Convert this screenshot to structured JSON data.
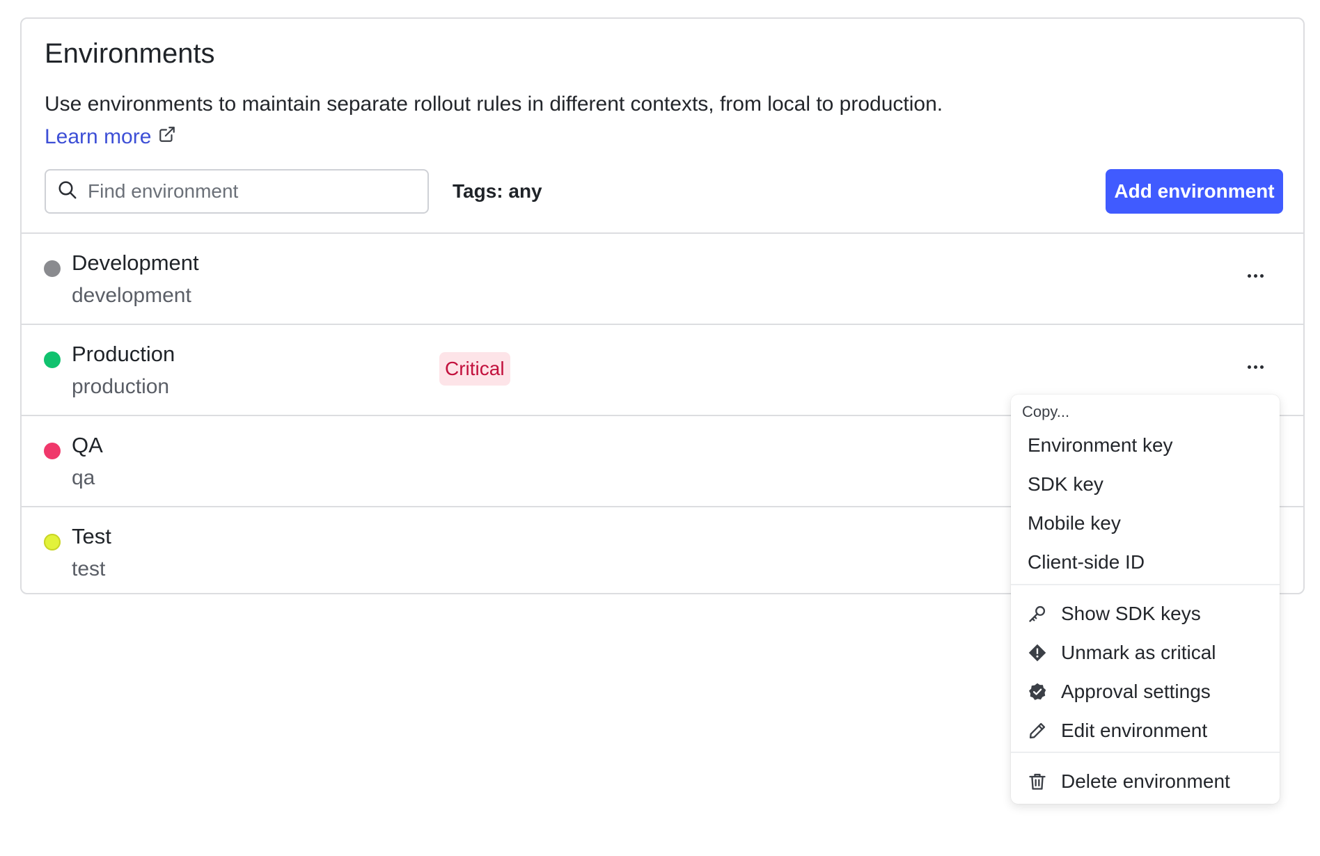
{
  "header": {
    "title": "Environments",
    "description": "Use environments to maintain separate rollout rules in different contexts, from local to production.",
    "learn_more": "Learn more"
  },
  "toolbar": {
    "search_placeholder": "Find environment",
    "tags_filter": "Tags: any",
    "add_button": "Add environment"
  },
  "environments": [
    {
      "name": "Development",
      "key": "development",
      "color": "#8a8b8f",
      "badge": ""
    },
    {
      "name": "Production",
      "key": "production",
      "color": "#10c26e",
      "badge": "Critical"
    },
    {
      "name": "QA",
      "key": "qa",
      "color": "#f0386b",
      "badge": ""
    },
    {
      "name": "Test",
      "key": "test",
      "color": "#e2f23a",
      "badge": ""
    }
  ],
  "menu": {
    "copy_label": "Copy...",
    "copy_items": [
      "Environment key",
      "SDK key",
      "Mobile key",
      "Client-side ID"
    ],
    "actions": [
      {
        "label": "Show SDK keys",
        "icon": "key-icon"
      },
      {
        "label": "Unmark as critical",
        "icon": "alert-diamond-icon"
      },
      {
        "label": "Approval settings",
        "icon": "verified-badge-icon"
      },
      {
        "label": "Edit environment",
        "icon": "pencil-icon"
      }
    ],
    "danger": {
      "label": "Delete environment",
      "icon": "trash-icon"
    }
  },
  "colors": {
    "accent": "#405bff",
    "link": "#3d4fd6",
    "critical_bg": "#fde4e8",
    "critical_text": "#c2113d"
  }
}
